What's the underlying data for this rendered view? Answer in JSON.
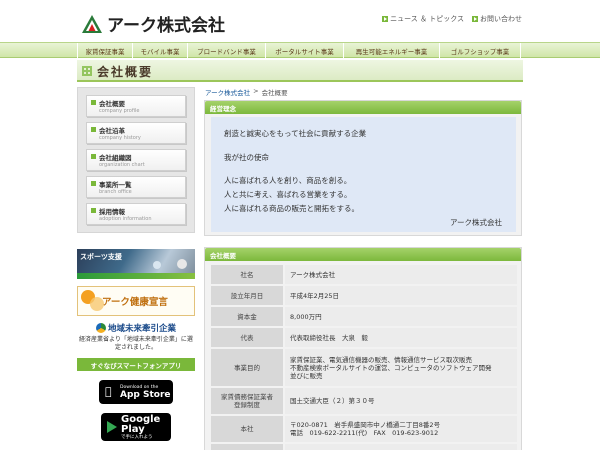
{
  "header": {
    "logo_text": "アーク株式会社",
    "links": [
      "ニュース ＆ トピックス",
      "お問い合わせ"
    ]
  },
  "nav": [
    "家賃保証事業",
    "モバイル事業",
    "ブロードバンド事業",
    "ポータルサイト事業",
    "再生可能エネルギー事業",
    "ゴルフショップ事業"
  ],
  "page_title": "会社概要",
  "breadcrumb": {
    "home": "アーク株式会社",
    "sep": ">",
    "current": "会社概要"
  },
  "sidebar": {
    "menu": [
      {
        "jp": "会社概要",
        "en": "company profile"
      },
      {
        "jp": "会社沿革",
        "en": "company history"
      },
      {
        "jp": "会社組織図",
        "en": "organization chart"
      },
      {
        "jp": "事業所一覧",
        "en": "branch office"
      },
      {
        "jp": "採用情報",
        "en": "adoption information"
      }
    ],
    "sports_banner": "スポーツ支援",
    "health_banner": "アーク健康宣言",
    "region_title": "地域未来牽引企業",
    "region_sub": "経済産業省より「地域未来牽引企業」に選定されました。",
    "apps_heading": "すぐなびスマートフォンアプリ",
    "app_store": {
      "small": "Download on the",
      "big": "App Store"
    },
    "google_play": {
      "big": "Google Play",
      "small": "で手に入れよう"
    }
  },
  "philosophy": {
    "heading": "経営理念",
    "lines": [
      "創造と誠実心をもって社会に貢献する企業",
      "我が社の使命",
      "人に喜ばれる人を創り、商品を創る。",
      "人と共に考え、喜ばれる営業をする。",
      "人に喜ばれる商品の販売と開拓をする。"
    ],
    "signature": "アーク株式会社"
  },
  "overview": {
    "heading": "会社概要",
    "rows": [
      {
        "label": "社名",
        "value": [
          "アーク株式会社"
        ]
      },
      {
        "label": "設立年月日",
        "value": [
          "平成4年2月25日"
        ]
      },
      {
        "label": "資本金",
        "value": [
          "8,000万円"
        ]
      },
      {
        "label": "代表",
        "value": [
          "代表取締役社長　大泉　毅"
        ]
      },
      {
        "label": "事業目的",
        "value": [
          "家賃保証業、電気通信機器の販売、情報通信サービス取次販売",
          "不動産検索ポータルサイトの運営、コンピュータのソフトウェア開発",
          "並びに販売"
        ]
      },
      {
        "label": "家賃債務保証業者\n登録制度",
        "value": [
          "国土交通大臣（２）第３０号"
        ]
      },
      {
        "label": "本社",
        "value": [
          "〒020-0871　岩手県盛岡市中ノ橋通二丁目8番2号",
          "電話　019-622-2211(代)　FAX　019-623-9012"
        ]
      },
      {
        "label": "",
        "value": [
          ""
        ]
      }
    ]
  }
}
